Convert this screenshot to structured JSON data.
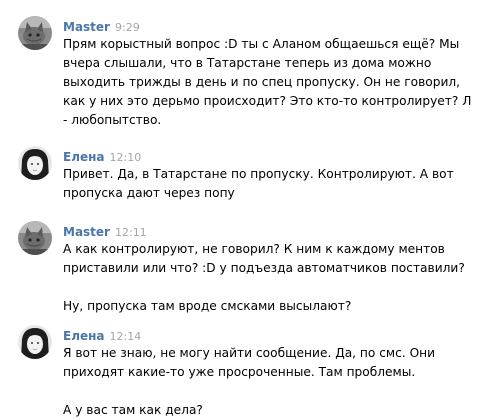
{
  "messages": [
    {
      "author": "Master",
      "time": "9:29",
      "avatar": "cat-photo",
      "paragraphs": [
        "Прям корыстный вопрос :D ты с Аланом общаешься ещё? Мы вчера слышали, что в Татарстане теперь из дома можно выходить трижды в день и по спец пропуску. Он не говорил, как у них это дерьмо происходит? Это кто-то контролирует? Л - любопытство."
      ]
    },
    {
      "author": "Елена",
      "time": "12:10",
      "avatar": "girl-photo",
      "paragraphs": [
        "Привет. Да, в Татарстане по пропуску. Контролируют. А вот пропуска дают через попу"
      ]
    },
    {
      "author": "Master",
      "time": "12:11",
      "avatar": "cat-photo",
      "paragraphs": [
        "А как контролируют, не говорил? К ним к каждому ментов приставили или что? :D у подъезда автоматчиков поставили?",
        "Ну, пропуска там вроде смсками высылают?"
      ]
    },
    {
      "author": "Елена",
      "time": "12:14",
      "avatar": "girl-photo",
      "paragraphs": [
        "Я вот не знаю, не могу найти сообщение. Да, по смс. Они приходят какие-то уже просроченные. Там проблемы.",
        "А у вас там как дела?"
      ]
    }
  ],
  "colors": {
    "author": "#4a76a8",
    "time": "#a0a6ad",
    "text": "#000000"
  }
}
